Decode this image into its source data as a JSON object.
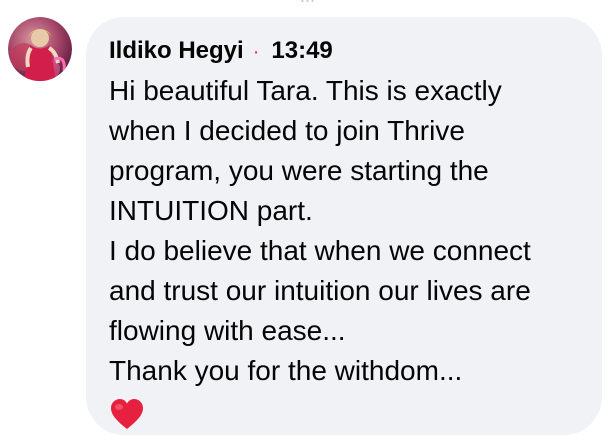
{
  "comment": {
    "author": "Ildiko Hegyi",
    "separator": "·",
    "time": "13:49",
    "text_lines": [
      "Hi beautiful Tara. This is exactly",
      "when I decided to join Thrive",
      "program, you were starting the",
      "INTUITION part.",
      "I do believe that when we connect",
      "and trust our intuition our lives are",
      "flowing with ease...",
      "Thank you for the withdom..."
    ],
    "reaction_icon": "red-heart-icon"
  },
  "colors": {
    "bubble_bg": "#f0f2f5",
    "separator": "#f02849",
    "heart": "#e5213f",
    "text": "#050505"
  },
  "top_crop_text": "..."
}
